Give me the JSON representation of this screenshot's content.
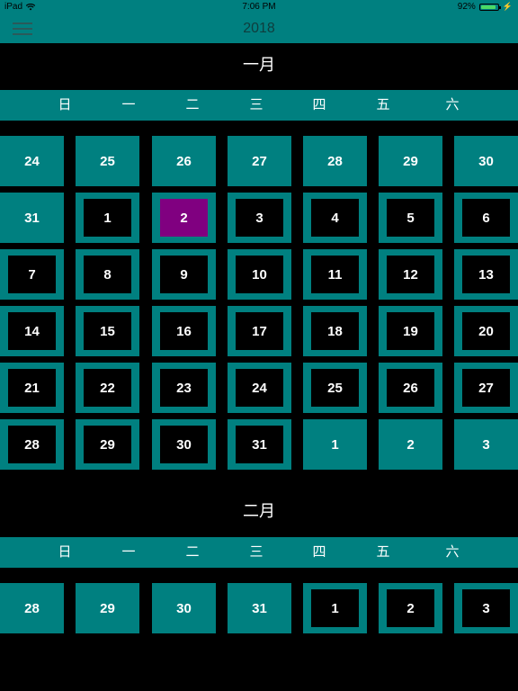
{
  "status_bar": {
    "device": "iPad",
    "time": "7:06 PM",
    "battery_text": "92%",
    "battery_level": 0.92,
    "colors": {
      "battery": "#4cd964"
    }
  },
  "nav": {
    "title": "2018",
    "menu_icon": "hamburger-menu-icon"
  },
  "theme": {
    "teal": "#008080",
    "background": "#000000",
    "selected": "#800080"
  },
  "weekdays": [
    "日",
    "一",
    "二",
    "三",
    "四",
    "五",
    "六"
  ],
  "months": [
    {
      "title": "一月",
      "days": [
        {
          "d": "24",
          "s": "other"
        },
        {
          "d": "25",
          "s": "other"
        },
        {
          "d": "26",
          "s": "other"
        },
        {
          "d": "27",
          "s": "other"
        },
        {
          "d": "28",
          "s": "other"
        },
        {
          "d": "29",
          "s": "other"
        },
        {
          "d": "30",
          "s": "other"
        },
        {
          "d": "31",
          "s": "other"
        },
        {
          "d": "1",
          "s": "current"
        },
        {
          "d": "2",
          "s": "selected"
        },
        {
          "d": "3",
          "s": "current"
        },
        {
          "d": "4",
          "s": "current"
        },
        {
          "d": "5",
          "s": "current"
        },
        {
          "d": "6",
          "s": "current"
        },
        {
          "d": "7",
          "s": "current"
        },
        {
          "d": "8",
          "s": "current"
        },
        {
          "d": "9",
          "s": "current"
        },
        {
          "d": "10",
          "s": "current"
        },
        {
          "d": "11",
          "s": "current"
        },
        {
          "d": "12",
          "s": "current"
        },
        {
          "d": "13",
          "s": "current"
        },
        {
          "d": "14",
          "s": "current"
        },
        {
          "d": "15",
          "s": "current"
        },
        {
          "d": "16",
          "s": "current"
        },
        {
          "d": "17",
          "s": "current"
        },
        {
          "d": "18",
          "s": "current"
        },
        {
          "d": "19",
          "s": "current"
        },
        {
          "d": "20",
          "s": "current"
        },
        {
          "d": "21",
          "s": "current"
        },
        {
          "d": "22",
          "s": "current"
        },
        {
          "d": "23",
          "s": "current"
        },
        {
          "d": "24",
          "s": "current"
        },
        {
          "d": "25",
          "s": "current"
        },
        {
          "d": "26",
          "s": "current"
        },
        {
          "d": "27",
          "s": "current"
        },
        {
          "d": "28",
          "s": "current"
        },
        {
          "d": "29",
          "s": "current"
        },
        {
          "d": "30",
          "s": "current"
        },
        {
          "d": "31",
          "s": "current"
        },
        {
          "d": "1",
          "s": "other"
        },
        {
          "d": "2",
          "s": "other"
        },
        {
          "d": "3",
          "s": "other"
        }
      ]
    },
    {
      "title": "二月",
      "days": [
        {
          "d": "28",
          "s": "other"
        },
        {
          "d": "29",
          "s": "other"
        },
        {
          "d": "30",
          "s": "other"
        },
        {
          "d": "31",
          "s": "other"
        },
        {
          "d": "1",
          "s": "current"
        },
        {
          "d": "2",
          "s": "current"
        },
        {
          "d": "3",
          "s": "current"
        }
      ]
    }
  ]
}
